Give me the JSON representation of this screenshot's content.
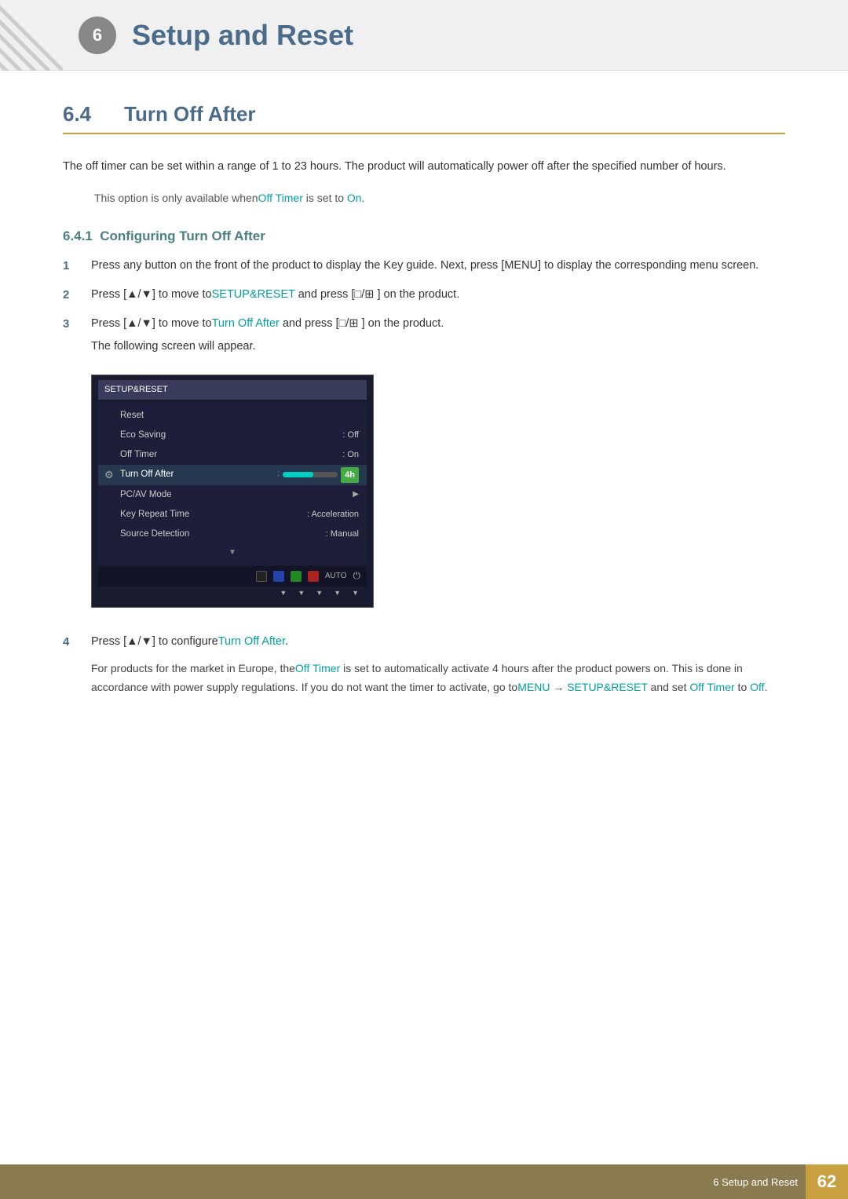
{
  "header": {
    "chapter_num": "6",
    "title_prefix": "Setup",
    "title_suffix": "and Reset",
    "icon_label": "6"
  },
  "section": {
    "number": "6.4",
    "title": "Turn Off After"
  },
  "body_paragraph": "The off timer can be set within a range of 1 to 23 hours. The product will automatically power off after the specified number of hours.",
  "note": {
    "prefix": "This option is only available when",
    "highlight1": "Off Timer",
    "middle": " is set to",
    "highlight2": "On",
    "suffix": "."
  },
  "subsection": {
    "number": "6.4.1",
    "title": "Configuring Turn Off After"
  },
  "steps": [
    {
      "num": "1",
      "text": "Press any button on the front of the product to display the Key guide. Next, press [MENU] to display the corresponding menu screen."
    },
    {
      "num": "2",
      "text_before": "Press [▲/▼] to move to",
      "highlight": "SETUP&RESET",
      "text_after": " and press [□/⊞ ] on the product."
    },
    {
      "num": "3",
      "text_before": "Press [▲/▼] to move to",
      "highlight": "Turn Off After",
      "text_after": " and press [□/⊞ ] on the product.",
      "sub": "The following screen will appear."
    },
    {
      "num": "4",
      "text_before": "Press [▲/▼] to configure",
      "highlight": "Turn Off After",
      "text_after": "."
    }
  ],
  "osd": {
    "title": "SETUP&RESET",
    "rows": [
      {
        "label": "Reset",
        "value": "",
        "highlighted": false,
        "has_gear": false
      },
      {
        "label": "Eco Saving",
        "value": ": Off",
        "highlighted": false,
        "has_gear": false
      },
      {
        "label": "Off Timer",
        "value": ": On",
        "highlighted": false,
        "has_gear": false
      },
      {
        "label": "Turn Off After",
        "value": "",
        "highlighted": true,
        "has_gear": true,
        "has_slider": true
      },
      {
        "label": "PC/AV Mode",
        "value": "",
        "highlighted": false,
        "has_gear": false,
        "has_arrow": true
      },
      {
        "label": "Key Repeat Time",
        "value": ": Acceleration",
        "highlighted": false,
        "has_gear": false
      },
      {
        "label": "Source Detection",
        "value": ": Manual",
        "highlighted": false,
        "has_gear": false
      }
    ]
  },
  "step4_note": {
    "para1_before": "For products for the market in Europe, the",
    "para1_highlight": "Off Timer",
    "para1_after": " is set to automatically activate 4 hours after the product powers on. This is done in accordance with power supply regulations. If you do not want the timer to activate, go to",
    "para1_menu": "MENU",
    "para1_arrow": " → ",
    "para1_setup": "SETUP&RESET",
    "para1_end_before": " and set ",
    "para1_off_timer": "Off Timer",
    "para1_end": " to ",
    "para1_off": "Off",
    "para1_final": "."
  },
  "footer": {
    "text": "6 Setup and Reset",
    "page": "62"
  }
}
